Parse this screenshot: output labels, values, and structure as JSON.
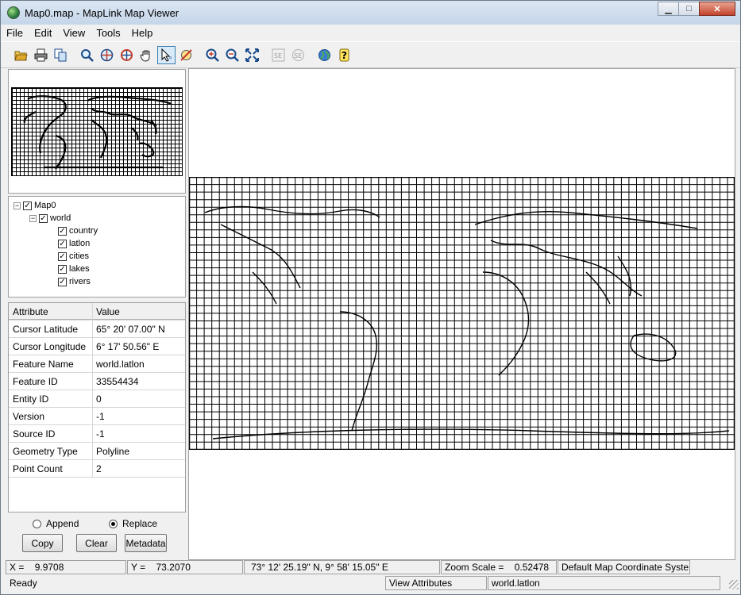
{
  "window": {
    "title": "Map0.map - MapLink Map Viewer",
    "buttons": {
      "minimize": "▁",
      "maximize": "□",
      "close": "✕"
    }
  },
  "menu": [
    "File",
    "Edit",
    "View",
    "Tools",
    "Help"
  ],
  "toolbar": {
    "icons": [
      "open-icon",
      "print-icon",
      "copy-icon",
      "zoom-icon",
      "pan-icon",
      "zoom-to-point-icon",
      "grab-icon",
      "select-arrow-icon",
      "no-draw-icon",
      "zoom-in-icon",
      "zoom-out-icon",
      "zoom-extent-icon",
      "se-icon",
      "sel-icon",
      "globe-icon",
      "help-icon"
    ]
  },
  "tree": {
    "root": "Map0",
    "group": "world",
    "layers": [
      "country",
      "latlon",
      "cities",
      "lakes",
      "rivers"
    ],
    "expander_open": "−"
  },
  "attributes": {
    "headers": {
      "attribute": "Attribute",
      "value": "Value"
    },
    "rows": [
      {
        "name": "Cursor Latitude",
        "value": "65° 20' 07.00\" N"
      },
      {
        "name": "Cursor Longitude",
        "value": "6° 17' 50.56\" E"
      },
      {
        "name": "Feature Name",
        "value": "world.latlon"
      },
      {
        "name": "Feature ID",
        "value": "33554434"
      },
      {
        "name": "Entity ID",
        "value": "0"
      },
      {
        "name": "Version",
        "value": "-1"
      },
      {
        "name": "Source ID",
        "value": "-1"
      },
      {
        "name": "Geometry Type",
        "value": "Polyline"
      },
      {
        "name": "Point Count",
        "value": "2"
      }
    ]
  },
  "selection_mode": {
    "append": "Append",
    "replace": "Replace",
    "selected": "replace"
  },
  "buttons": {
    "copy": "Copy",
    "clear": "Clear",
    "metadata": "Metadata"
  },
  "status": {
    "x_label": "X =",
    "x_value": "9.9708",
    "y_label": "Y =",
    "y_value": "73.2070",
    "latlon": "73° 12' 25.19\" N,   9° 58' 15.05\" E",
    "zoom_label": "Zoom Scale =",
    "zoom_value": "0.52478",
    "coord_system": "Default Map Coordinate Systen",
    "ready": "Ready",
    "view_attributes": "View Attributes",
    "layer": "world.latlon"
  }
}
